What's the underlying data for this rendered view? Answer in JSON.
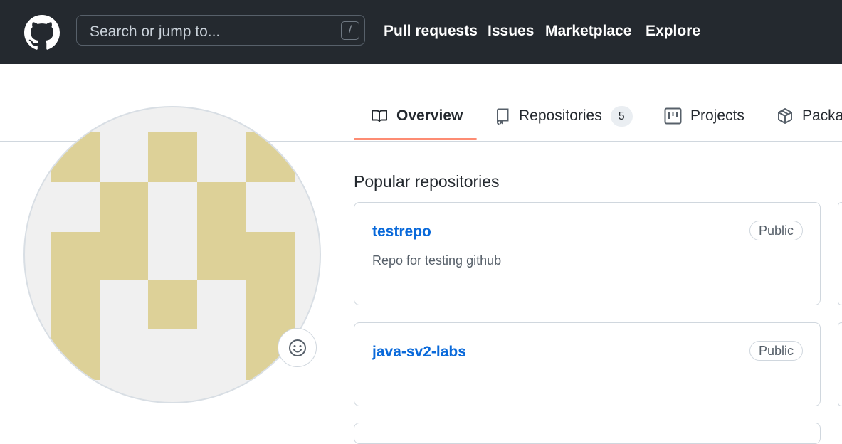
{
  "header": {
    "search_placeholder": "Search or jump to...",
    "slash_key": "/",
    "nav": {
      "pull_requests": "Pull requests",
      "issues": "Issues",
      "marketplace": "Marketplace",
      "explore": "Explore"
    }
  },
  "tabs": {
    "overview": "Overview",
    "repositories": "Repositories",
    "repositories_count": "5",
    "projects": "Projects",
    "packages": "Packages"
  },
  "main": {
    "popular_title": "Popular repositories",
    "repos": [
      {
        "name": "testrepo",
        "visibility": "Public",
        "description": "Repo for testing github"
      },
      {
        "name": "java-sv2-labs",
        "visibility": "Public",
        "description": ""
      }
    ]
  },
  "colors": {
    "header_bg": "#24292f",
    "link_blue": "#0969da",
    "tab_underline": "#fd8c73",
    "identicon": "#ddd198"
  },
  "icons": [
    "github-logo-icon",
    "book-icon",
    "repo-icon",
    "project-icon",
    "package-icon",
    "smiley-icon"
  ]
}
